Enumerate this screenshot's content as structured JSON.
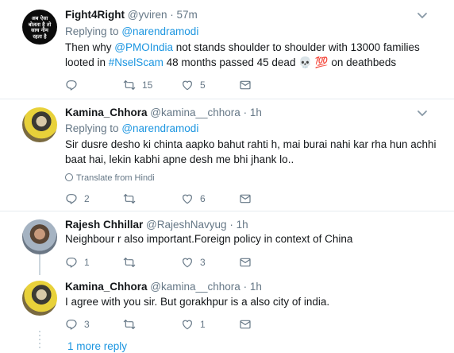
{
  "tweets": [
    {
      "name": "Fight4Right",
      "handle": "@yviren",
      "time": "57m",
      "reply_prefix": "Replying to",
      "reply_to": "@narendramodi",
      "line1_a": "Then why ",
      "line1_mention": "@PMOIndia",
      "line1_b": " not stands  shoulder to shoulder with 13000 families",
      "line2_a": "looted in ",
      "line2_hashtag": "#NselScam",
      "line2_b": " 48 months passed 45 dead 💀 💯 on deathbeds",
      "replies": "",
      "retweets": "15",
      "likes": "5",
      "avatar_text": "अब ऐसा बोलता है तो साथ नीम रहता है"
    },
    {
      "name": "Kamina_Chhora",
      "handle": "@kamina__chhora",
      "time": "1h",
      "reply_prefix": "Replying to",
      "reply_to": "@narendramodi",
      "line1": "Sir dusre desho ki chinta aapko bahut rahti h, mai burai nahi kar rha hun achhi",
      "line2": "baat hai, lekin kabhi apne desh me bhi jhank lo..",
      "translate": "Translate from Hindi",
      "replies": "2",
      "retweets": "",
      "likes": "6"
    },
    {
      "name": "Rajesh Chhillar",
      "handle": "@RajeshNavyug",
      "time": "1h",
      "line1": "Neighbour r also important.Foreign policy in context of China",
      "replies": "1",
      "retweets": "",
      "likes": "3"
    },
    {
      "name": "Kamina_Chhora",
      "handle": "@kamina__chhora",
      "time": "1h",
      "line1": "I agree with you sir. But gorakhpur is a also city of india.",
      "replies": "3",
      "retweets": "",
      "likes": "1"
    }
  ],
  "more_replies": "1 more reply",
  "dot": "·",
  "icons": [
    "reply-icon",
    "retweet-icon",
    "like-icon",
    "direct-message-icon",
    "caret-down-icon",
    "globe-icon"
  ],
  "colors": {
    "link": "#1b95e0",
    "muted": "#657786",
    "text": "#14171a",
    "border": "#e6ecf0"
  }
}
